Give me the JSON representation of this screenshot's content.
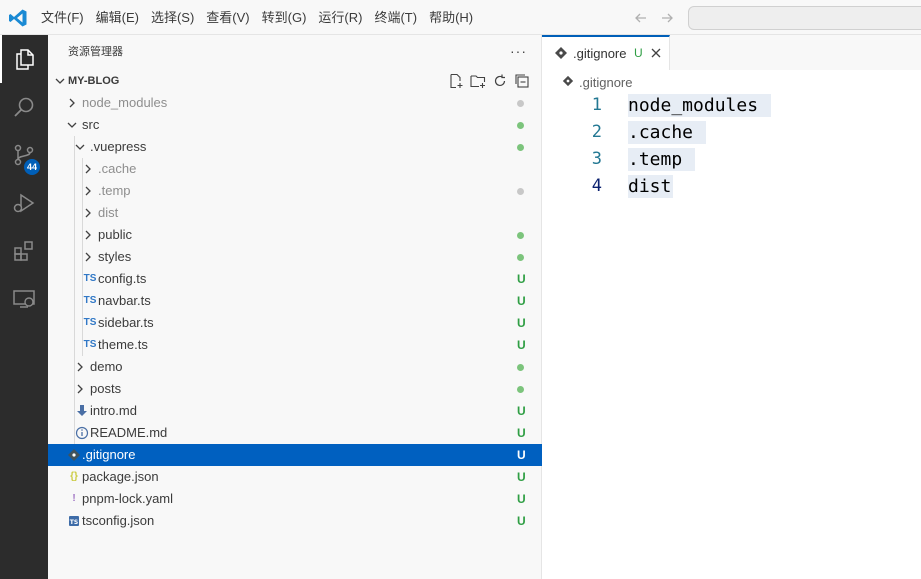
{
  "menubar": {
    "items": [
      "文件(F)",
      "编辑(E)",
      "选择(S)",
      "查看(V)",
      "转到(G)",
      "运行(R)",
      "终端(T)",
      "帮助(H)"
    ]
  },
  "activity_bar": {
    "items": [
      "explorer-icon",
      "search-icon",
      "source-control-icon",
      "run-debug-icon",
      "extensions-icon",
      "remote-explorer-icon"
    ],
    "source_control_badge": "44"
  },
  "explorer": {
    "title": "资源管理器",
    "more": "···",
    "project_name": "MY-BLOG",
    "tree": [
      {
        "label": "node_modules",
        "depth": 0,
        "kind": "folder",
        "expanded": false,
        "dim": true,
        "mark": "dot-gray"
      },
      {
        "label": "src",
        "depth": 0,
        "kind": "folder",
        "expanded": true,
        "mark": "dot-green"
      },
      {
        "label": ".vuepress",
        "depth": 1,
        "kind": "folder",
        "expanded": true,
        "mark": "dot-green"
      },
      {
        "label": ".cache",
        "depth": 2,
        "kind": "folder",
        "expanded": false,
        "dim": true,
        "mark": ""
      },
      {
        "label": ".temp",
        "depth": 2,
        "kind": "folder",
        "expanded": false,
        "dim": true,
        "mark": "dot-gray"
      },
      {
        "label": "dist",
        "depth": 2,
        "kind": "folder",
        "expanded": false,
        "dim": true,
        "mark": ""
      },
      {
        "label": "public",
        "depth": 2,
        "kind": "folder",
        "expanded": false,
        "mark": "dot-green"
      },
      {
        "label": "styles",
        "depth": 2,
        "kind": "folder",
        "expanded": false,
        "mark": "dot-green"
      },
      {
        "label": "config.ts",
        "depth": 2,
        "kind": "ts",
        "icon": "TS",
        "mark": "U"
      },
      {
        "label": "navbar.ts",
        "depth": 2,
        "kind": "ts",
        "icon": "TS",
        "mark": "U"
      },
      {
        "label": "sidebar.ts",
        "depth": 2,
        "kind": "ts",
        "icon": "TS",
        "mark": "U"
      },
      {
        "label": "theme.ts",
        "depth": 2,
        "kind": "ts",
        "icon": "TS",
        "mark": "U"
      },
      {
        "label": "demo",
        "depth": 1,
        "kind": "folder",
        "expanded": false,
        "mark": "dot-green"
      },
      {
        "label": "posts",
        "depth": 1,
        "kind": "folder",
        "expanded": false,
        "mark": "dot-green"
      },
      {
        "label": "intro.md",
        "depth": 1,
        "kind": "md",
        "mark": "U"
      },
      {
        "label": "README.md",
        "depth": 1,
        "kind": "info",
        "mark": "U"
      },
      {
        "label": ".gitignore",
        "depth": 0,
        "kind": "git",
        "selected": true,
        "mark": "U"
      },
      {
        "label": "package.json",
        "depth": 0,
        "kind": "json",
        "icon": "{}",
        "mark": "U"
      },
      {
        "label": "pnpm-lock.yaml",
        "depth": 0,
        "kind": "yaml",
        "icon": "!",
        "mark": "U"
      },
      {
        "label": "tsconfig.json",
        "depth": 0,
        "kind": "tsconfig",
        "icon": "TS",
        "mark": "U"
      }
    ]
  },
  "editor": {
    "tab_label": ".gitignore",
    "tab_status": "U",
    "breadcrumb": ".gitignore",
    "lines": [
      {
        "n": "1",
        "text": "node_modules "
      },
      {
        "n": "2",
        "text": ".cache "
      },
      {
        "n": "3",
        "text": ".temp "
      },
      {
        "n": "4",
        "text": "dist",
        "current": true
      }
    ]
  },
  "colors": {
    "accent": "#005fb8",
    "selection": "#0060c0",
    "git_added": "#2f9e44",
    "activity_bar": "#2c2c2c"
  }
}
